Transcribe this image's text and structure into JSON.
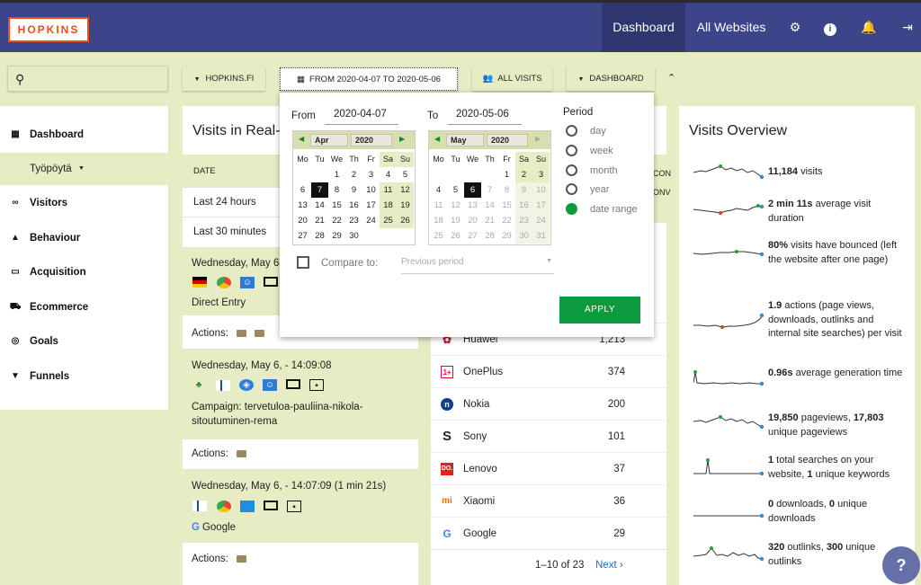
{
  "header": {
    "logo": "HOPKINS",
    "nav_dashboard": "Dashboard",
    "nav_all_websites": "All Websites",
    "icons": [
      "gear-icon",
      "info-icon",
      "bell-icon",
      "logout-icon"
    ]
  },
  "controls": {
    "site": "HOPKINS.FI",
    "date_range": "FROM 2020-04-07 TO 2020-05-06",
    "segment": "ALL VISITS",
    "dashboard": "DASHBOARD"
  },
  "sidebar": {
    "items": [
      {
        "label": "Dashboard",
        "icon": "grid-icon"
      },
      {
        "label": "Visitors",
        "icon": "binoculars-icon"
      },
      {
        "label": "Behaviour",
        "icon": "bell-icon"
      },
      {
        "label": "Acquisition",
        "icon": "window-icon"
      },
      {
        "label": "Ecommerce",
        "icon": "cart-icon"
      },
      {
        "label": "Goals",
        "icon": "target-icon"
      },
      {
        "label": "Funnels",
        "icon": "funnel-icon"
      }
    ],
    "sub_item": "Työpöytä"
  },
  "realtime": {
    "title": "Visits in Real-t",
    "col_date": "DATE",
    "last24": "Last 24 hours",
    "last30": "Last 30 minutes",
    "visits": [
      {
        "time": "Wednesday, May 6",
        "referrer": "Direct Entry",
        "actions": "Actions:"
      },
      {
        "time": "Wednesday, May 6, - 14:09:08",
        "referrer": "Campaign: tervetuloa-pauliina-nikola-sitoutuminen-rema",
        "actions": "Actions:"
      },
      {
        "time": "Wednesday, May 6, - 14:07:09 (1 min 21s)",
        "referrer": "Google",
        "actions": "Actions:"
      }
    ]
  },
  "devices": {
    "header_partial": [
      "CON",
      "ONV"
    ],
    "rows": [
      {
        "name": "Huawei",
        "value": "1,213",
        "icon": "huawei-icon"
      },
      {
        "name": "OnePlus",
        "value": "374",
        "icon": "oneplus-icon"
      },
      {
        "name": "Nokia",
        "value": "200",
        "icon": "nokia-icon"
      },
      {
        "name": "Sony",
        "value": "101",
        "icon": "sony-icon"
      },
      {
        "name": "Lenovo",
        "value": "37",
        "icon": "lenovo-icon"
      },
      {
        "name": "Xiaomi",
        "value": "36",
        "icon": "xiaomi-icon"
      },
      {
        "name": "Google",
        "value": "29",
        "icon": "google-icon"
      }
    ],
    "pager": "1–10 of 23",
    "next": "Next ›"
  },
  "overview": {
    "title": "Visits Overview",
    "items": [
      {
        "b1": "11,184",
        "t1": " visits",
        "b2": "",
        "t2": ""
      },
      {
        "b1": "2 min 11s",
        "t1": " average visit duration",
        "b2": "",
        "t2": ""
      },
      {
        "b1": "80%",
        "t1": " visits have bounced (left the website after one page)",
        "b2": "",
        "t2": ""
      },
      {
        "b1": "1.9",
        "t1": " actions (page views, downloads, outlinks and internal site searches) per visit",
        "b2": "",
        "t2": ""
      },
      {
        "b1": "0.96s",
        "t1": " average generation time",
        "b2": "",
        "t2": ""
      },
      {
        "b1": "19,850",
        "t1": " pageviews, ",
        "b2": "17,803",
        "t2": " unique pageviews"
      },
      {
        "b1": "1",
        "t1": " total searches on your website, ",
        "b2": "1",
        "t2": " unique keywords"
      },
      {
        "b1": "0",
        "t1": " downloads, ",
        "b2": "0",
        "t2": " unique downloads"
      },
      {
        "b1": "320",
        "t1": " outlinks, ",
        "b2": "300",
        "t2": " unique outlinks"
      }
    ]
  },
  "datepicker": {
    "from_label": "From",
    "from_value": "2020-04-07",
    "to_label": "To",
    "to_value": "2020-05-06",
    "from_month": "Apr",
    "from_year": "2020",
    "to_month": "May",
    "to_year": "2020",
    "weekdays": [
      "Mo",
      "Tu",
      "We",
      "Th",
      "Fr",
      "Sa",
      "Su"
    ],
    "period_label": "Period",
    "periods": [
      "day",
      "week",
      "month",
      "year",
      "date range"
    ],
    "selected_period": "date range",
    "compare_label": "Compare to:",
    "compare_placeholder": "Previous period",
    "apply": "APPLY"
  },
  "help": "?"
}
